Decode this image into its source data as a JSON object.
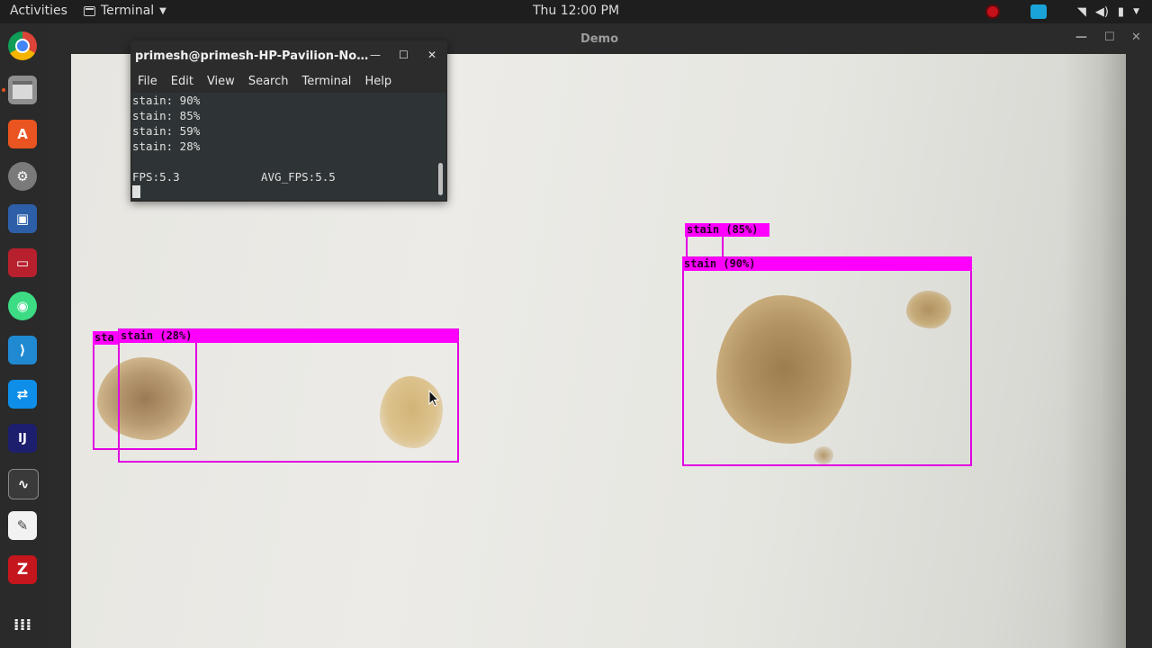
{
  "topbar": {
    "activities": "Activities",
    "app_menu": "Terminal",
    "clock": "Thu 12:00 PM"
  },
  "demo_window": {
    "title": "Demo"
  },
  "terminal": {
    "title": "primesh@primesh-HP-Pavilion-Note...",
    "menu": [
      "File",
      "Edit",
      "View",
      "Search",
      "Terminal",
      "Help"
    ],
    "lines": [
      "stain: 90%",
      "stain: 85%",
      "stain: 59%",
      "stain: 28%"
    ],
    "fps": "FPS:5.3",
    "avg_fps": "AVG_FPS:5.5"
  },
  "detections": {
    "box_a": "stain (85%)",
    "box_b": "stain (90%)",
    "box_c": "stain (28%)",
    "box_d": "sta"
  },
  "colors": {
    "box": "#e100e1",
    "label_bg": "#ff00ff"
  },
  "dock_icons": [
    "chrome-icon",
    "files-icon",
    "software-center-icon",
    "settings-icon",
    "virtualbox-icon",
    "app-icon",
    "android-studio-icon",
    "vscode-icon",
    "teamviewer-icon",
    "intellij-icon",
    "system-monitor-icon",
    "text-editor-icon",
    "filezilla-icon",
    "show-apps-icon"
  ]
}
